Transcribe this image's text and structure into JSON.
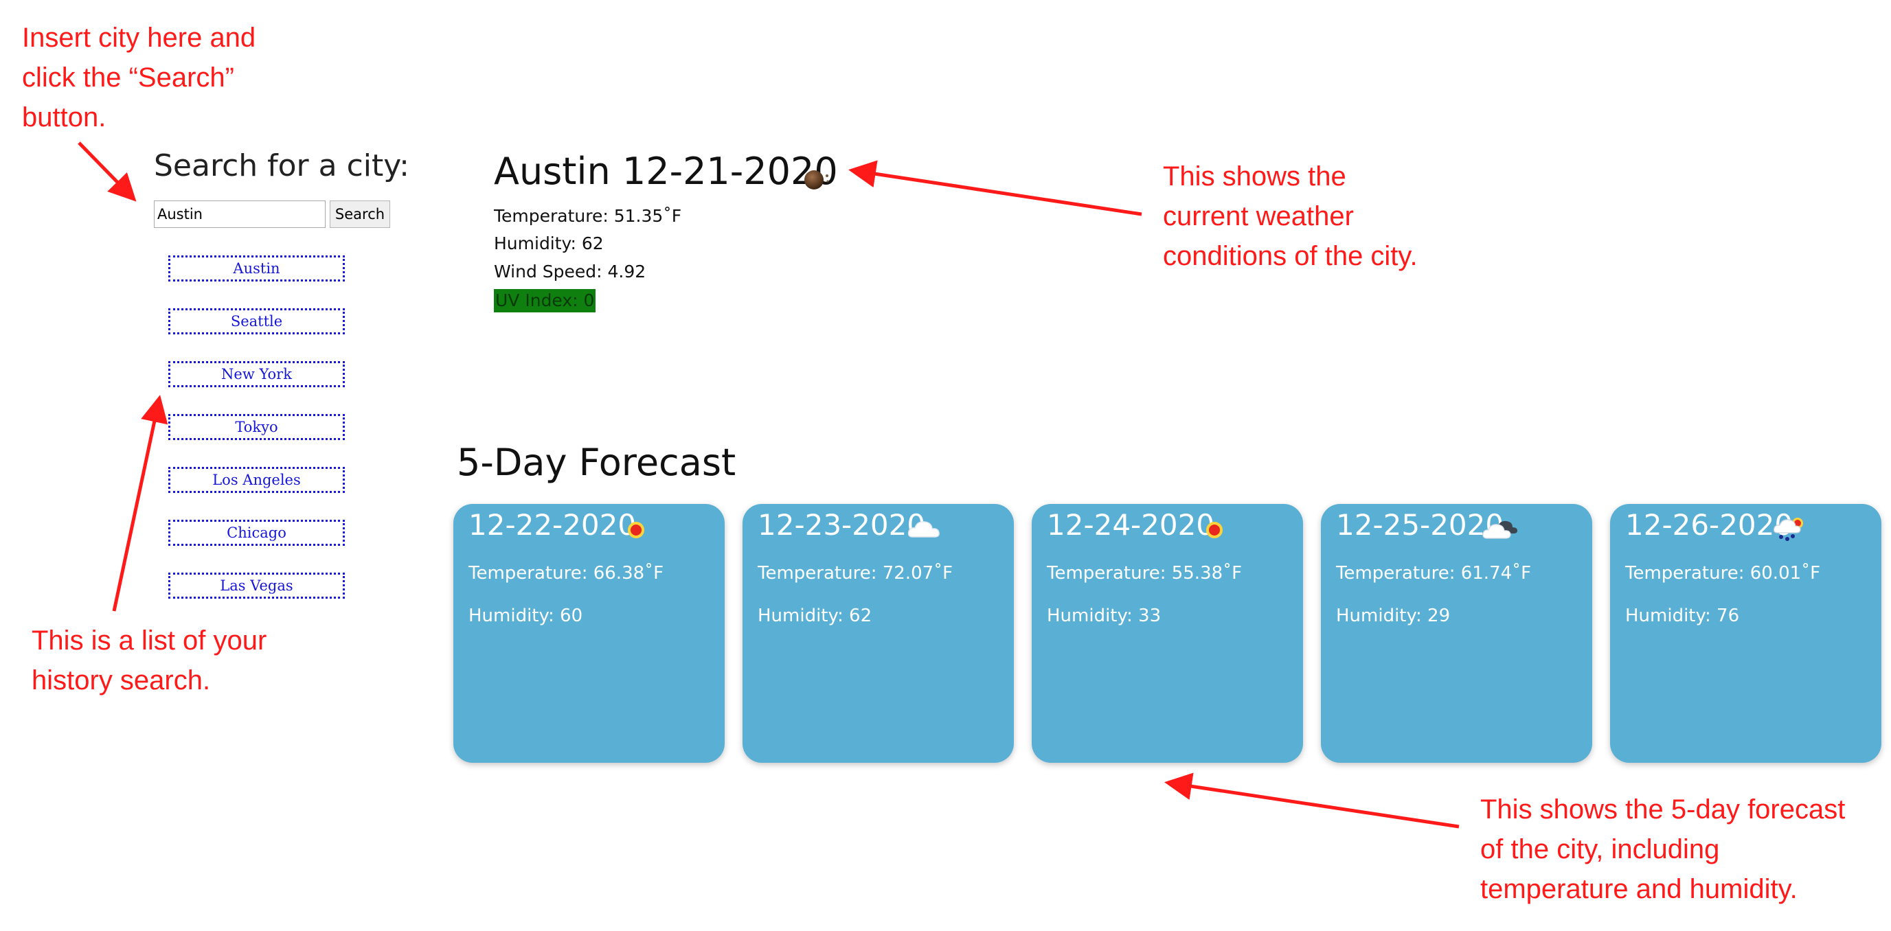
{
  "search": {
    "heading": "Search for a city:",
    "input_value": "Austin",
    "button_label": "Search"
  },
  "history": [
    "Austin",
    "Seattle",
    "New York",
    "Tokyo",
    "Los Angeles",
    "Chicago",
    "Las Vegas"
  ],
  "current": {
    "title": "Austin 12-21-2020",
    "icon": "moon-icon",
    "temperature": "Temperature: 51.35˚F",
    "humidity": "Humidity: 62",
    "wind": "Wind Speed: 4.92",
    "uv": "UV Index: 0",
    "uv_color": "#0f7f0f"
  },
  "forecast": {
    "heading": "5-Day Forecast",
    "card_color": "#5ab0d4",
    "days": [
      {
        "date": "12-22-2020",
        "icon": "sun-icon",
        "temperature": "Temperature: 66.38˚F",
        "humidity": "Humidity: 60"
      },
      {
        "date": "12-23-2020",
        "icon": "cloud-icon",
        "temperature": "Temperature: 72.07˚F",
        "humidity": "Humidity: 62"
      },
      {
        "date": "12-24-2020",
        "icon": "sun-icon",
        "temperature": "Temperature: 55.38˚F",
        "humidity": "Humidity: 33"
      },
      {
        "date": "12-25-2020",
        "icon": "broken-clouds-icon",
        "temperature": "Temperature: 61.74˚F",
        "humidity": "Humidity: 29"
      },
      {
        "date": "12-26-2020",
        "icon": "rain-sun-icon",
        "temperature": "Temperature: 60.01˚F",
        "humidity": "Humidity: 76"
      }
    ]
  },
  "annotations": {
    "search_note": "Insert city here and click the “Search” button.",
    "current_note": "This shows the current weather conditions of the city.",
    "history_note": "This is a list of your history search.",
    "forecast_note": "This shows the 5-day forecast of the city, including temperature and humidity.",
    "color": "#ff1a1a"
  }
}
